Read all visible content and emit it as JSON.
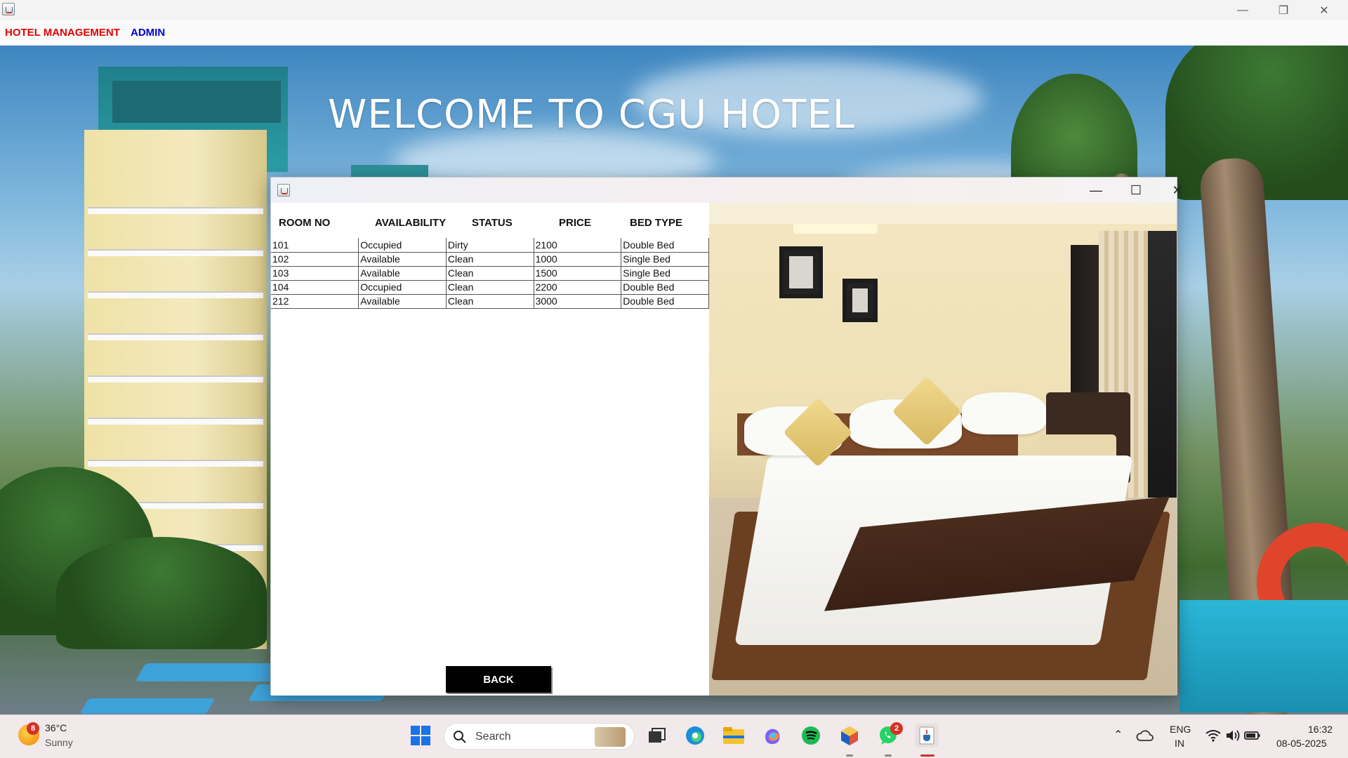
{
  "outer_window": {
    "menu": [
      "HOTEL MANAGEMENT",
      "ADMIN"
    ],
    "menu_colors": [
      "#e00000",
      "#0000d0"
    ]
  },
  "background": {
    "welcome_text": "WELCOME TO CGU HOTEL"
  },
  "rooms_dialog": {
    "columns": [
      "ROOM NO",
      "AVAILABILITY",
      "STATUS",
      "PRICE",
      "BED TYPE"
    ],
    "rows": [
      [
        "101",
        "Occupied",
        "Dirty",
        "2100",
        "Double Bed"
      ],
      [
        "102",
        "Available",
        "Clean",
        "1000",
        "Single Bed"
      ],
      [
        "103",
        "Available",
        "Clean",
        "1500",
        "Single Bed"
      ],
      [
        "104",
        "Occupied",
        "Clean",
        "2200",
        "Double Bed"
      ],
      [
        "212",
        "Available",
        "Clean",
        "3000",
        "Double Bed"
      ]
    ],
    "back_label": "BACK"
  },
  "taskbar": {
    "weather_badge": "8",
    "temperature": "36°C",
    "condition": "Sunny",
    "search_placeholder": "Search",
    "whatsapp_badge": "2",
    "lang_line1": "ENG",
    "lang_line2": "IN",
    "time": "16:32",
    "date": "08-05-2025"
  }
}
